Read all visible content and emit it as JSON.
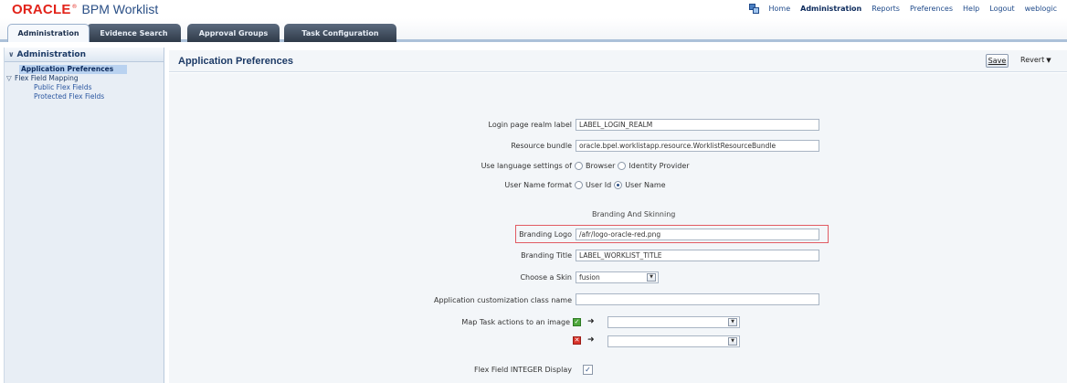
{
  "header": {
    "logo_brand": "ORACLE",
    "logo_reg": "®",
    "logo_product": "BPM Worklist",
    "nav": [
      {
        "label": "Home",
        "active": false
      },
      {
        "label": "Administration",
        "active": true
      },
      {
        "label": "Reports",
        "active": false
      },
      {
        "label": "Preferences",
        "active": false
      },
      {
        "label": "Help",
        "active": false
      },
      {
        "label": "Logout",
        "active": false
      }
    ],
    "user": "weblogic"
  },
  "tabs": [
    {
      "label": "Administration",
      "active": true
    },
    {
      "label": "Evidence Search",
      "active": false
    },
    {
      "label": "Approval Groups",
      "active": false
    },
    {
      "label": "Task Configuration",
      "active": false
    }
  ],
  "sidebar": {
    "title": "Administration",
    "items": [
      {
        "label": "Application Preferences",
        "type": "selected"
      },
      {
        "label": "Flex Field Mapping",
        "type": "group"
      },
      {
        "label": "Public Flex Fields",
        "type": "child"
      },
      {
        "label": "Protected Flex Fields",
        "type": "child"
      }
    ]
  },
  "main": {
    "title": "Application Preferences",
    "save_label": "Save",
    "revert_label": "Revert",
    "form": {
      "login_realm_label": "Login page realm label",
      "login_realm_value": "LABEL_LOGIN_REALM",
      "resource_bundle_label": "Resource bundle",
      "resource_bundle_value": "oracle.bpel.worklistapp.resource.WorklistResourceBundle",
      "language_label": "Use language settings of",
      "language_options": [
        "Browser",
        "Identity Provider"
      ],
      "language_selected": null,
      "username_format_label": "User Name format",
      "username_format_options": [
        "User Id",
        "User Name"
      ],
      "username_format_selected": "User Name",
      "branding_section": "Branding And Skinning",
      "branding_logo_label": "Branding Logo",
      "branding_logo_value": "/afr/logo-oracle-red.png",
      "branding_title_label": "Branding Title",
      "branding_title_value": "LABEL_WORKLIST_TITLE",
      "skin_label": "Choose a Skin",
      "skin_value": "fusion",
      "customization_class_label": "Application customization class name",
      "customization_class_value": "",
      "map_actions_label": "Map Task actions to an image",
      "map_approve_value": "",
      "map_reject_value": "",
      "flex_integer_label": "Flex Field INTEGER Display",
      "flex_integer_checked": true
    }
  },
  "colors": {
    "brand_red": "#e2231a",
    "link_blue": "#1f4a8a",
    "highlight_red": "#e15b63",
    "selected_bg": "#b9d2f0"
  }
}
